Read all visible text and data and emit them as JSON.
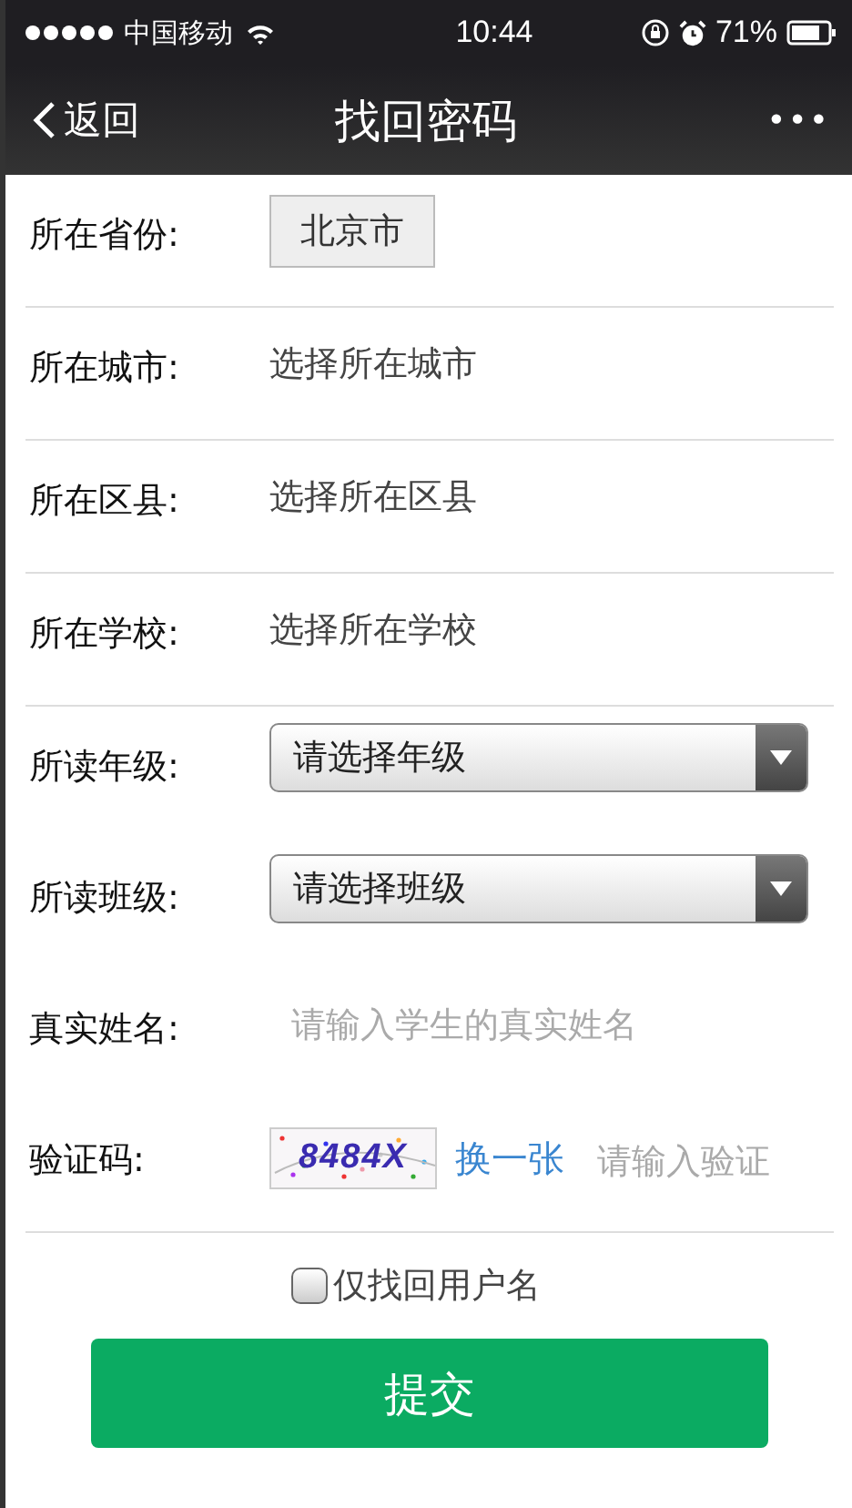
{
  "status_bar": {
    "carrier": "中国移动",
    "time": "10:44",
    "battery": "71%"
  },
  "nav": {
    "back": "返回",
    "title": "找回密码",
    "more": "•••"
  },
  "rows": [
    {
      "kind": "button",
      "label": "所在省份:",
      "value": "北京市",
      "divider": true
    },
    {
      "kind": "text",
      "label": "所在城市:",
      "value": "选择所在城市",
      "divider": true
    },
    {
      "kind": "text",
      "label": "所在区县:",
      "value": "选择所在区县",
      "divider": true
    },
    {
      "kind": "text",
      "label": "所在学校:",
      "value": "选择所在学校",
      "divider": true
    },
    {
      "kind": "select",
      "label": "所读年级:",
      "value": "请选择年级",
      "divider": false
    },
    {
      "kind": "select",
      "label": "所读班级:",
      "value": "请选择班级",
      "divider": false
    },
    {
      "kind": "input",
      "label": "真实姓名:",
      "placeholder": "请输入学生的真实姓名",
      "divider": false
    },
    {
      "kind": "captcha",
      "label": "验证码:",
      "code": "8484X",
      "refresh": "换一张",
      "placeholder": "请输入验证",
      "divider": true
    }
  ],
  "only_username": {
    "label": "仅找回用户名",
    "checked": false
  },
  "submit": "提交"
}
